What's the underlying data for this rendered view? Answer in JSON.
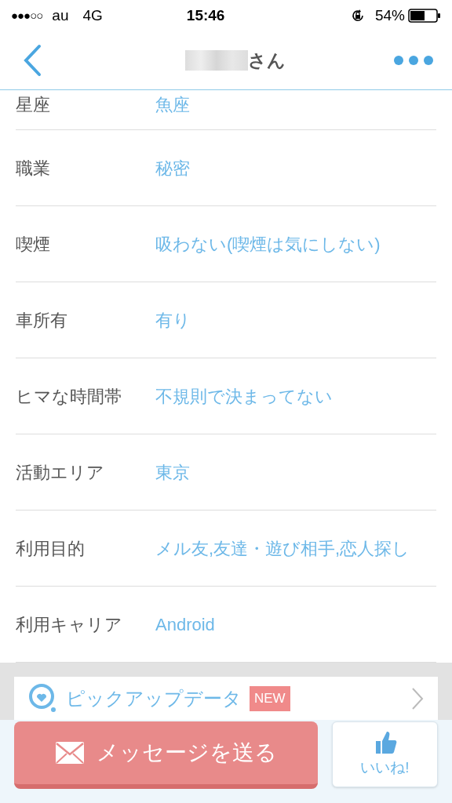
{
  "status_bar": {
    "signal": "●●●○○",
    "carrier": "au",
    "network": "4G",
    "time": "15:46",
    "battery": "54%"
  },
  "header": {
    "title_suffix": "さん"
  },
  "profile_rows": [
    {
      "label": "星座",
      "value": "魚座"
    },
    {
      "label": "職業",
      "value": "秘密"
    },
    {
      "label": "喫煙",
      "value": "吸わない(喫煙は気にしない)"
    },
    {
      "label": "車所有",
      "value": "有り"
    },
    {
      "label": "ヒマな時間帯",
      "value": "不規則で決まってない"
    },
    {
      "label": "活動エリア",
      "value": "東京"
    },
    {
      "label": "利用目的",
      "value": "メル友,友達・遊び相手,恋人探し"
    },
    {
      "label": "利用キャリア",
      "value": "Android"
    }
  ],
  "pickup_card": {
    "title": "ピックアップデータ",
    "badge": "NEW"
  },
  "actions": {
    "message_button": "メッセージを送る",
    "like_button": "いいね!"
  }
}
